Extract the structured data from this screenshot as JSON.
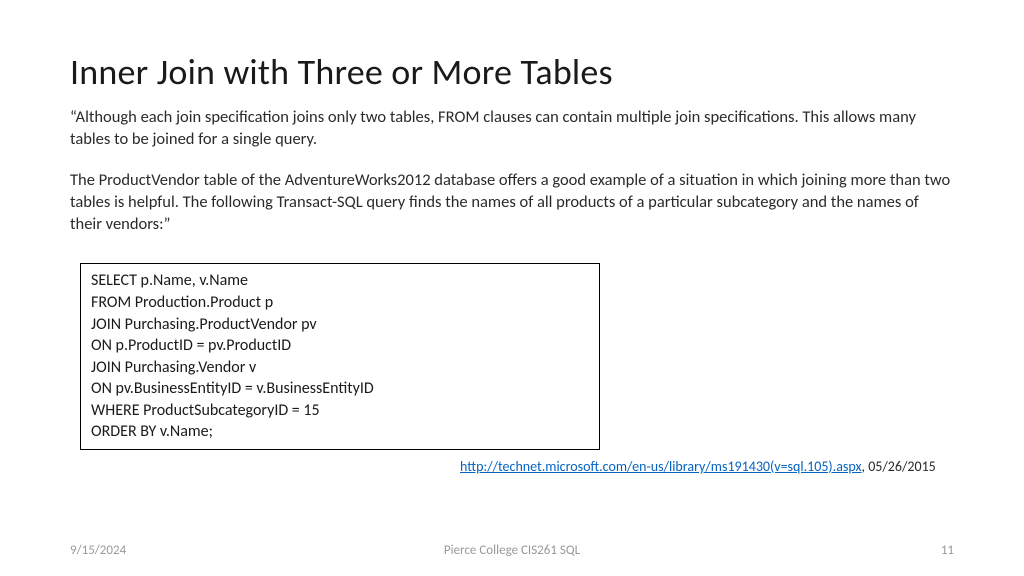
{
  "slide": {
    "title": "Inner Join with Three or More Tables",
    "paragraph1": "“Although each join specification joins only two tables, FROM clauses can contain multiple join specifications. This allows many tables to be joined for a single query.",
    "paragraph2": "The ProductVendor table of the AdventureWorks2012 database offers a good example of a situation in which joining more than two tables is helpful. The following Transact-SQL query finds the names of all products of a particular subcategory and the names of their vendors:”",
    "code": "SELECT p.Name, v.Name\nFROM Production.Product p\nJOIN Purchasing.ProductVendor pv\nON p.ProductID = pv.ProductID\nJOIN Purchasing.Vendor v\nON pv.BusinessEntityID = v.BusinessEntityID\nWHERE ProductSubcategoryID = 15\nORDER BY v.Name;",
    "reference": {
      "url_text": "http://technet.microsoft.com/en-us/library/ms191430(v=sql.105).aspx",
      "date_suffix": ", 05/26/2015"
    }
  },
  "footer": {
    "date": "9/15/2024",
    "center": "Pierce College CIS261 SQL",
    "page": "11"
  }
}
